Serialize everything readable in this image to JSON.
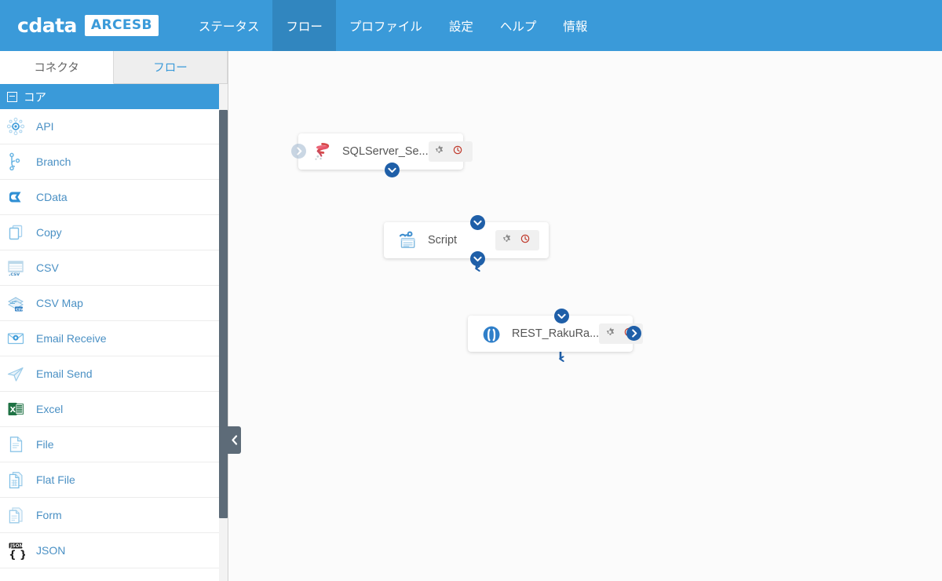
{
  "app": {
    "logo_text": "cdata",
    "logo_badge": "ARCESB"
  },
  "topnav": {
    "items": [
      {
        "label": "ステータス",
        "active": false,
        "name": "nav-status"
      },
      {
        "label": "フロー",
        "active": true,
        "name": "nav-flow"
      },
      {
        "label": "プロファイル",
        "active": false,
        "name": "nav-profile"
      },
      {
        "label": "設定",
        "active": false,
        "name": "nav-settings"
      },
      {
        "label": "ヘルプ",
        "active": false,
        "name": "nav-help"
      },
      {
        "label": "情報",
        "active": false,
        "name": "nav-info"
      }
    ]
  },
  "sidebar": {
    "tabs": [
      {
        "label": "コネクタ",
        "active": true,
        "name": "tab-connectors"
      },
      {
        "label": "フロー",
        "active": false,
        "name": "tab-flows"
      }
    ],
    "group_header": "コア",
    "items": [
      {
        "label": "API",
        "icon": "api-icon"
      },
      {
        "label": "Branch",
        "icon": "branch-icon"
      },
      {
        "label": "CData",
        "icon": "cdata-icon"
      },
      {
        "label": "Copy",
        "icon": "copy-icon"
      },
      {
        "label": "CSV",
        "icon": "csv-icon"
      },
      {
        "label": "CSV Map",
        "icon": "csv-map-icon"
      },
      {
        "label": "Email Receive",
        "icon": "email-receive-icon"
      },
      {
        "label": "Email Send",
        "icon": "email-send-icon"
      },
      {
        "label": "Excel",
        "icon": "excel-icon"
      },
      {
        "label": "File",
        "icon": "file-icon"
      },
      {
        "label": "Flat File",
        "icon": "flat-file-icon"
      },
      {
        "label": "Form",
        "icon": "form-icon"
      },
      {
        "label": "JSON",
        "icon": "json-icon"
      }
    ]
  },
  "flow": {
    "nodes": [
      {
        "title": "SQLServer_Se...",
        "icon": "sqlserver-icon",
        "name": "flow-node-sqlserver"
      },
      {
        "title": "Script",
        "icon": "script-icon",
        "name": "flow-node-script"
      },
      {
        "title": "REST_RakuRa...",
        "icon": "rest-icon",
        "name": "flow-node-rest"
      }
    ]
  },
  "colors": {
    "brand_blue": "#3a9ad9",
    "nav_active_blue": "#3186bf",
    "connector_blue": "#1f5fa8",
    "link_blue": "#4a90c4",
    "canvas_bg": "#fbfbfb",
    "scrollbar_gray": "#5d6b78",
    "action_red": "#c0392b",
    "excel_green": "#1f7244"
  }
}
